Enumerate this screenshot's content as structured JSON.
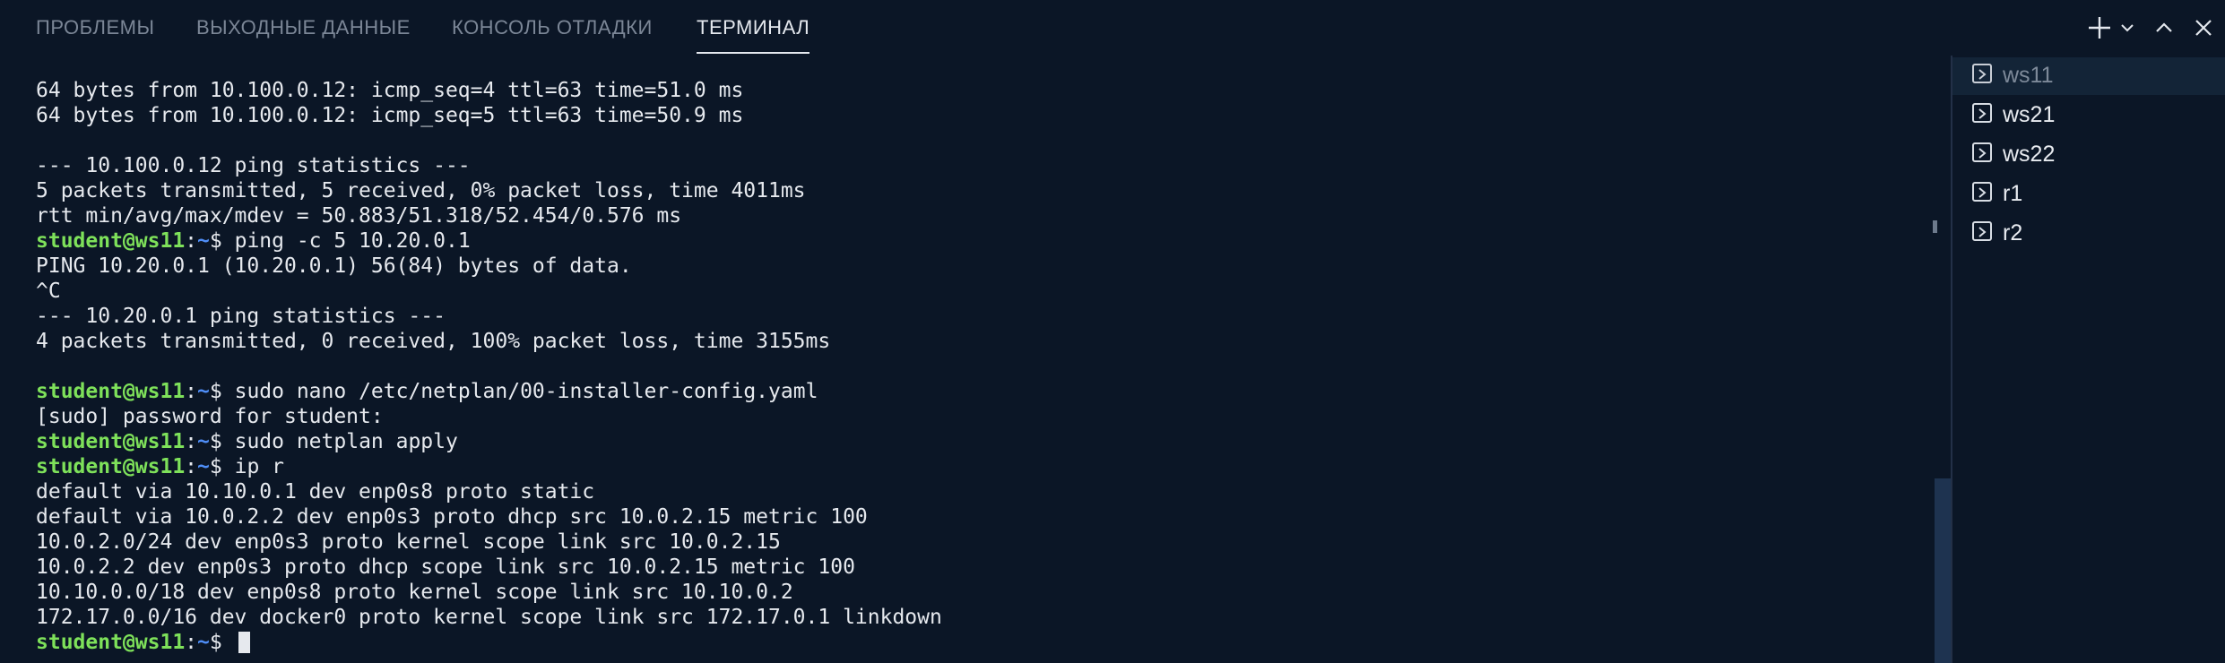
{
  "tabs": [
    {
      "label": "ПРОБЛЕМЫ",
      "active": false
    },
    {
      "label": "ВЫХОДНЫЕ ДАННЫЕ",
      "active": false
    },
    {
      "label": "КОНСОЛЬ ОТЛАДКИ",
      "active": false
    },
    {
      "label": "ТЕРМИНАЛ",
      "active": true
    }
  ],
  "toolbar": {
    "icons": [
      "plus-icon",
      "chevron-down-icon",
      "chevron-up-icon",
      "close-icon"
    ]
  },
  "prompt": {
    "user": "student@ws11",
    "colon": ":",
    "path": "~",
    "symbol": "$ "
  },
  "terminal_lines": [
    {
      "text": "64 bytes from 10.100.0.12: icmp_seq=4 ttl=63 time=51.0 ms"
    },
    {
      "text": "64 bytes from 10.100.0.12: icmp_seq=5 ttl=63 time=50.9 ms"
    },
    {
      "text": ""
    },
    {
      "text": "--- 10.100.0.12 ping statistics ---"
    },
    {
      "text": "5 packets transmitted, 5 received, 0% packet loss, time 4011ms"
    },
    {
      "text": "rtt min/avg/max/mdev = 50.883/51.318/52.454/0.576 ms"
    },
    {
      "prompt": true,
      "text": "ping -c 5 10.20.0.1"
    },
    {
      "text": "PING 10.20.0.1 (10.20.0.1) 56(84) bytes of data."
    },
    {
      "text": "^C"
    },
    {
      "text": "--- 10.20.0.1 ping statistics ---"
    },
    {
      "text": "4 packets transmitted, 0 received, 100% packet loss, time 3155ms"
    },
    {
      "text": ""
    },
    {
      "prompt": true,
      "text": "sudo nano /etc/netplan/00-installer-config.yaml"
    },
    {
      "text": "[sudo] password for student:"
    },
    {
      "prompt": true,
      "text": "sudo netplan apply"
    },
    {
      "prompt": true,
      "text": "ip r"
    },
    {
      "text": "default via 10.10.0.1 dev enp0s8 proto static"
    },
    {
      "text": "default via 10.0.2.2 dev enp0s3 proto dhcp src 10.0.2.15 metric 100"
    },
    {
      "text": "10.0.2.0/24 dev enp0s3 proto kernel scope link src 10.0.2.15"
    },
    {
      "text": "10.0.2.2 dev enp0s3 proto dhcp scope link src 10.0.2.15 metric 100"
    },
    {
      "text": "10.10.0.0/18 dev enp0s8 proto kernel scope link src 10.10.0.2"
    },
    {
      "text": "172.17.0.0/16 dev docker0 proto kernel scope link src 172.17.0.1 linkdown"
    },
    {
      "prompt": true,
      "text": "",
      "cursor": true
    }
  ],
  "sessions": [
    {
      "label": "ws11",
      "icon": "terminal-icon",
      "active": true
    },
    {
      "label": "ws21",
      "icon": "terminal-icon",
      "active": false
    },
    {
      "label": "ws22",
      "icon": "terminal-icon",
      "active": false
    },
    {
      "label": "r1",
      "icon": "terminal-icon",
      "active": false
    },
    {
      "label": "r2",
      "icon": "terminal-icon",
      "active": false
    }
  ],
  "colors": {
    "background": "#0b1626",
    "prompt_user": "#7ee15a",
    "prompt_path": "#4f8ef7",
    "text": "#e6e9ee",
    "tab_inactive": "#7b8696",
    "tab_active": "#e4e8ee"
  }
}
